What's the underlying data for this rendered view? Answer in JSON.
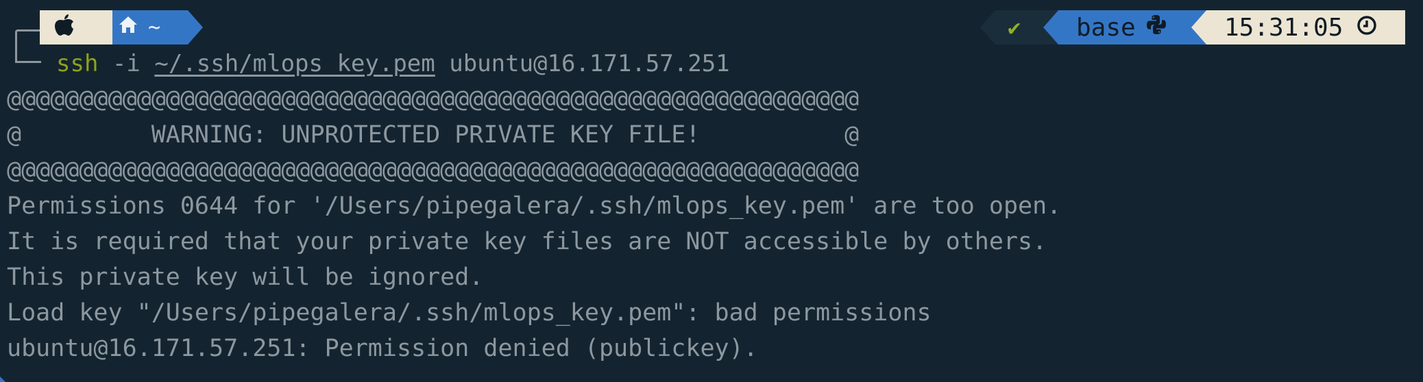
{
  "prompt": {
    "os_icon": "apple-icon",
    "home_icon": "home-icon",
    "directory": "~",
    "status_symbol": "✔",
    "env_name": "base",
    "env_icon": "python-icon",
    "time": "15:31:05",
    "time_icon": "clock-icon",
    "colors": {
      "light_segment": "#ece5d3",
      "blue_segment": "#3476c6",
      "status_green": "#8fb027",
      "command_green": "#8fa21c",
      "background": "#132430",
      "text": "#8d979f"
    }
  },
  "command": {
    "program": "ssh",
    "flag": "-i",
    "key_path": "~/.ssh/mlops_key.pem",
    "target": "ubuntu@16.171.57.251"
  },
  "output": [
    "@@@@@@@@@@@@@@@@@@@@@@@@@@@@@@@@@@@@@@@@@@@@@@@@@@@@@@@@@@@",
    "@         WARNING: UNPROTECTED PRIVATE KEY FILE!          @",
    "@@@@@@@@@@@@@@@@@@@@@@@@@@@@@@@@@@@@@@@@@@@@@@@@@@@@@@@@@@@",
    "Permissions 0644 for '/Users/pipegalera/.ssh/mlops_key.pem' are too open.",
    "It is required that your private key files are NOT accessible by others.",
    "This private key will be ignored.",
    "Load key \"/Users/pipegalera/.ssh/mlops_key.pem\": bad permissions",
    "ubuntu@16.171.57.251: Permission denied (publickey)."
  ]
}
